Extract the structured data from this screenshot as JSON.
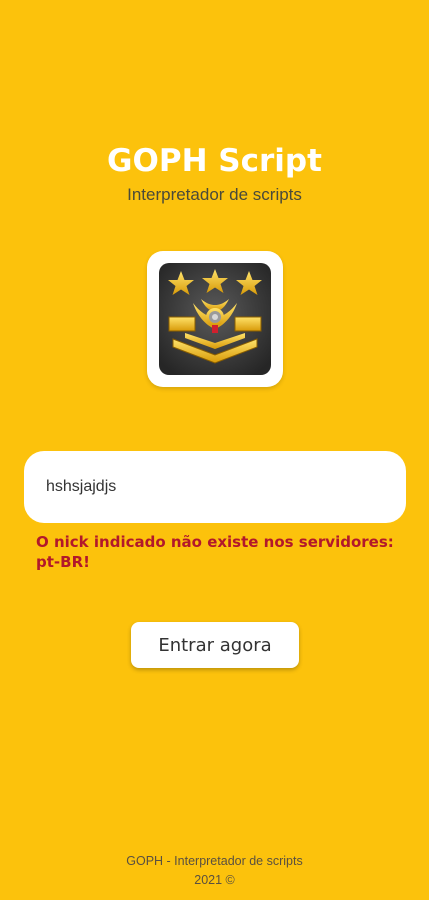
{
  "app": {
    "title": "GOPH Script",
    "subtitle": "Interpretador de scripts"
  },
  "logo": {
    "icon": "military-badge-icon"
  },
  "login": {
    "nick_value": "hshsjajdjs",
    "error_message": "O nick indicado não existe nos servidores: pt-BR!",
    "enter_label": "Entrar agora"
  },
  "footer": {
    "line1": "GOPH - Interpretador de scripts",
    "line2": "2021 ©"
  },
  "colors": {
    "background": "#FCC20C",
    "error": "#B2182B",
    "title": "#FFFFFF"
  }
}
